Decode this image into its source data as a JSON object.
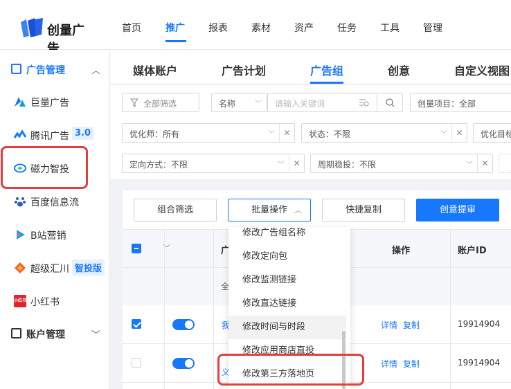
{
  "app": {
    "brand": "创量广告",
    "colors": {
      "accent": "#1677ff",
      "highlight": "#e43d3d"
    }
  },
  "topnav": {
    "items": [
      "首页",
      "推广",
      "报表",
      "素材",
      "资产",
      "任务",
      "工具",
      "管理"
    ],
    "active": "推广"
  },
  "sidebar": {
    "group_ad": {
      "label": "广告管理",
      "icon": "ad-icon",
      "chevron": "︿"
    },
    "items": [
      {
        "label": "巨量广告",
        "icon": "juliang-icon"
      },
      {
        "label": "腾讯广告",
        "badge": "3.0",
        "icon": "tencent-icon"
      },
      {
        "label": "磁力智投",
        "icon": "cili-icon"
      },
      {
        "label": "百度信息流",
        "icon": "baidu-icon"
      },
      {
        "label": "B站营销",
        "icon": "bilibili-icon"
      },
      {
        "label": "超级汇川",
        "badge": "智投版",
        "icon": "huichuan-icon"
      },
      {
        "label": "小红书",
        "icon": "xiaohongshu-icon",
        "icon_text": "小红书"
      }
    ],
    "group_account": {
      "label": "账户管理",
      "icon": "account-icon",
      "chevron": "﹀"
    }
  },
  "tabs": {
    "items": [
      "媒体账户",
      "广告计划",
      "广告组",
      "创意",
      "自定义视图"
    ],
    "active": "广告组"
  },
  "filters": {
    "all_filter": "全部筛选",
    "name_select": "名称",
    "keyword_placeholder": "请输入关键词",
    "project": "创量项目：全部",
    "optimizer": "优化师：所有",
    "status": "状态：不限",
    "optimize_target": "优化目标",
    "targeting": "定向方式：不限",
    "cycle_bid": "周期稳投：不限"
  },
  "toolbar": {
    "combo_filter": "组合筛选",
    "batch_ops": "批量操作",
    "quick_copy": "快捷复制",
    "creative_submit": "创意提审"
  },
  "table": {
    "col_name_partial": "广",
    "col_ops": "操作",
    "col_account": "账户ID",
    "sub_header_partial": "全",
    "rows": [
      {
        "name_partial": "我",
        "ops": [
          "详情",
          "复制"
        ],
        "account_id": "19914904"
      },
      {
        "name_partial": "义",
        "ops": [
          "详情",
          "复制"
        ],
        "account_id": "19914904"
      }
    ]
  },
  "batch_menu": {
    "items": [
      "修改广告组名称",
      "修改定向包",
      "修改监测链接",
      "修改直达链接",
      "修改时间与时段",
      "修改应用商店直投",
      "修改第三方落地页"
    ],
    "hovered": "修改时间与时段",
    "highlighted": "修改第三方落地页"
  }
}
